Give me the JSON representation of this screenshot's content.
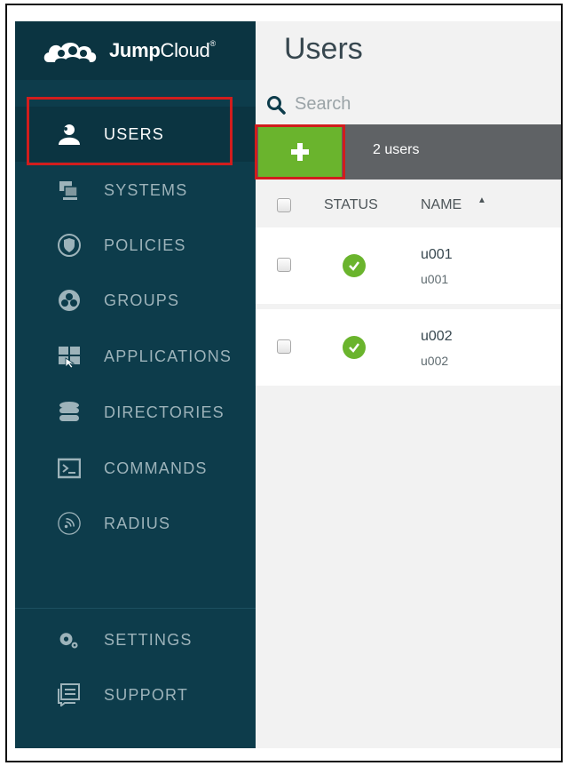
{
  "brand": {
    "name_bold": "Jump",
    "name_light": "Cloud",
    "trademark": "®"
  },
  "sidebar": {
    "items": [
      {
        "label": "USERS",
        "icon": "user-icon",
        "active": true
      },
      {
        "label": "SYSTEMS",
        "icon": "systems-icon",
        "active": false
      },
      {
        "label": "POLICIES",
        "icon": "shield-icon",
        "active": false
      },
      {
        "label": "GROUPS",
        "icon": "groups-icon",
        "active": false
      },
      {
        "label": "APPLICATIONS",
        "icon": "applications-icon",
        "active": false
      },
      {
        "label": "DIRECTORIES",
        "icon": "database-icon",
        "active": false
      },
      {
        "label": "COMMANDS",
        "icon": "terminal-icon",
        "active": false
      },
      {
        "label": "RADIUS",
        "icon": "radius-icon",
        "active": false
      }
    ],
    "bottom_items": [
      {
        "label": "SETTINGS",
        "icon": "gears-icon"
      },
      {
        "label": "SUPPORT",
        "icon": "support-icon"
      }
    ]
  },
  "main": {
    "title": "Users",
    "search": {
      "placeholder": "Search"
    },
    "toolbar": {
      "add_symbol": "+",
      "count_text": "2 users"
    },
    "table": {
      "columns": [
        "STATUS",
        "NAME"
      ],
      "sort_indicator": "▲",
      "rows": [
        {
          "name": "u001",
          "sub": "u001",
          "status": "active"
        },
        {
          "name": "u002",
          "sub": "u002",
          "status": "active"
        }
      ]
    }
  },
  "colors": {
    "sidebar": "#0d3c4b",
    "accent_green": "#6ab42d",
    "toolbar": "#5f6265",
    "highlight": "#d11d1d"
  }
}
